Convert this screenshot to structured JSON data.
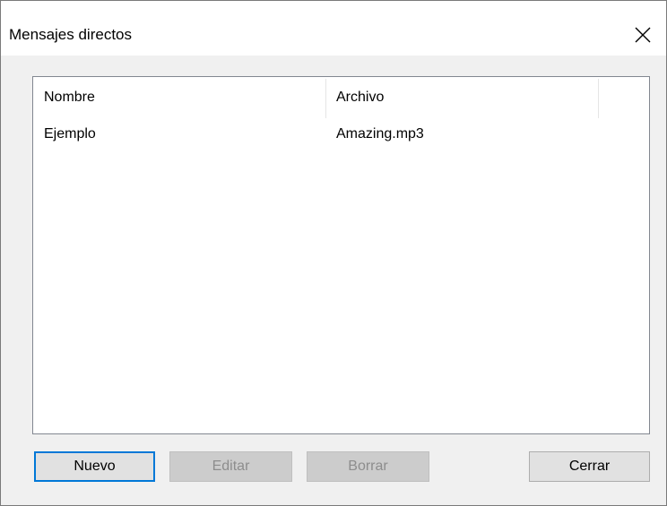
{
  "window": {
    "title": "Mensajes directos",
    "close_glyph": "close-icon"
  },
  "list": {
    "columns": [
      "Nombre",
      "Archivo"
    ],
    "rows": [
      {
        "nombre": "Ejemplo",
        "archivo": "Amazing.mp3"
      }
    ]
  },
  "buttons": {
    "nuevo": "Nuevo",
    "editar": "Editar",
    "borrar": "Borrar",
    "cerrar": "Cerrar"
  },
  "colors": {
    "focus_border": "#0078d7",
    "disabled_text": "#8d8d8d"
  }
}
